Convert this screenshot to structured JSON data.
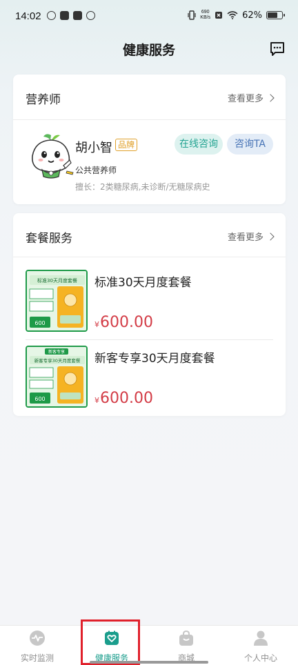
{
  "status_bar": {
    "time": "14:02",
    "net_speed_value": "690",
    "net_speed_unit": "KB/s",
    "battery": "62%"
  },
  "header": {
    "title": "健康服务",
    "message_icon": "message-icon"
  },
  "nutritionist_card": {
    "title": "营养师",
    "more_label": "查看更多",
    "doctor": {
      "name": "胡小智",
      "tag": "品牌",
      "role": "公共营养师",
      "specialty": "擅长：2类糖尿病,未诊断/无糖尿病史",
      "consult_button": "在线咨询",
      "ask_button": "咨询TA"
    }
  },
  "package_card": {
    "title": "套餐服务",
    "more_label": "查看更多",
    "items": [
      {
        "name": "标准30天月度套餐",
        "currency": "¥",
        "price": "600.00",
        "thumb_title": "标准30天月度套餐",
        "thumb_price": "600"
      },
      {
        "name": "新客专享30天月度套餐",
        "currency": "¥",
        "price": "600.00",
        "thumb_badge": "新客专享",
        "thumb_title": "新客专享30天月度套餐",
        "thumb_price": "600"
      }
    ]
  },
  "tabbar": {
    "tabs": [
      {
        "label": "实时监测",
        "icon": "pulse-icon",
        "active": false
      },
      {
        "label": "健康服务",
        "icon": "heart-bag-icon",
        "active": true
      },
      {
        "label": "商城",
        "icon": "shopping-bag-icon",
        "active": false
      },
      {
        "label": "个人中心",
        "icon": "person-icon",
        "active": false
      }
    ]
  },
  "colors": {
    "accent": "#1a9d8c",
    "price": "#d33c46",
    "brand_tag": "#e0a029",
    "highlight": "#e0202b"
  }
}
